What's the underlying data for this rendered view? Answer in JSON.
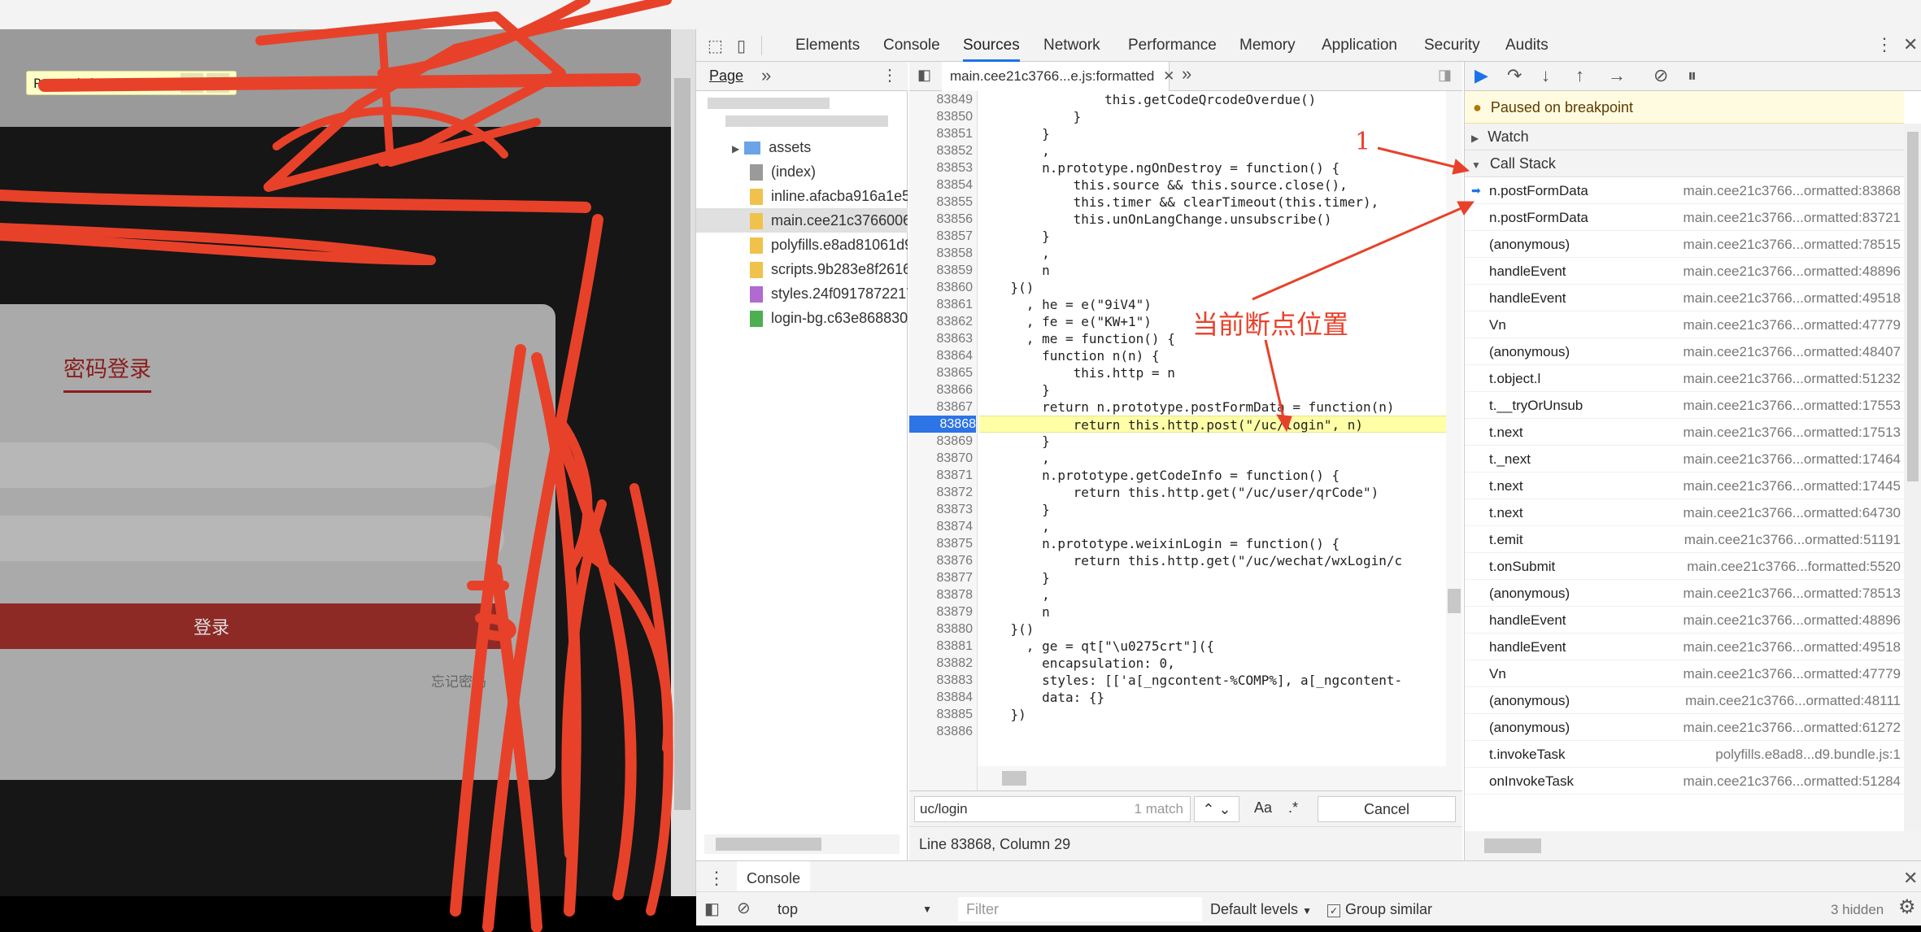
{
  "page": {
    "paused_label": "Paused in debugger",
    "login_title": "密码登录",
    "login_button": "登录",
    "forgot_link": "忘记密码"
  },
  "devtools": {
    "tabs": [
      "Elements",
      "Console",
      "Sources",
      "Network",
      "Performance",
      "Memory",
      "Application",
      "Security",
      "Audits"
    ],
    "active_tab": "Sources"
  },
  "navigator": {
    "header": "Page",
    "items": [
      {
        "label": "assets",
        "type": "folder"
      },
      {
        "label": "(index)",
        "type": "doc"
      },
      {
        "label": "inline.afacba916a1e5",
        "type": "js"
      },
      {
        "label": "main.cee21c3766006",
        "type": "js",
        "selected": true
      },
      {
        "label": "polyfills.e8ad81061d9",
        "type": "js"
      },
      {
        "label": "scripts.9b283e8f2616",
        "type": "js"
      },
      {
        "label": "styles.24f0917872217",
        "type": "js"
      },
      {
        "label": "login-bg.c63e868830",
        "type": "img"
      }
    ]
  },
  "editor": {
    "file_tab": "main.cee21c3766...e.js:formatted",
    "paused_line": "83868",
    "lines": [
      {
        "n": "83849",
        "code": "                this.getCodeQrcodeOverdue()"
      },
      {
        "n": "83850",
        "code": "            }"
      },
      {
        "n": "83851",
        "code": "        }"
      },
      {
        "n": "83852",
        "code": "        ,"
      },
      {
        "n": "83853",
        "code": "        n.prototype.ngOnDestroy = function() {"
      },
      {
        "n": "83854",
        "code": "            this.source && this.source.close(),"
      },
      {
        "n": "83855",
        "code": "            this.timer && clearTimeout(this.timer),"
      },
      {
        "n": "83856",
        "code": "            this.unOnLangChange.unsubscribe()"
      },
      {
        "n": "83857",
        "code": "        }"
      },
      {
        "n": "83858",
        "code": "        ,"
      },
      {
        "n": "83859",
        "code": "        n"
      },
      {
        "n": "83860",
        "code": "    }()"
      },
      {
        "n": "83861",
        "code": "      , he = e(\"9iV4\")"
      },
      {
        "n": "83862",
        "code": "      , fe = e(\"KW+1\")"
      },
      {
        "n": "83863",
        "code": "      , me = function() {"
      },
      {
        "n": "83864",
        "code": "        function n(n) {"
      },
      {
        "n": "83865",
        "code": "            this.http = n"
      },
      {
        "n": "83866",
        "code": "        }"
      },
      {
        "n": "83867",
        "code": "        return n.prototype.postFormData = function(n)"
      },
      {
        "n": "83868",
        "code": "            return this.http.post(\"/uc/login\", n)"
      },
      {
        "n": "83869",
        "code": "        }"
      },
      {
        "n": "83870",
        "code": "        ,"
      },
      {
        "n": "83871",
        "code": "        n.prototype.getCodeInfo = function() {"
      },
      {
        "n": "83872",
        "code": "            return this.http.get(\"/uc/user/qrCode\")"
      },
      {
        "n": "83873",
        "code": "        }"
      },
      {
        "n": "83874",
        "code": "        ,"
      },
      {
        "n": "83875",
        "code": "        n.prototype.weixinLogin = function() {"
      },
      {
        "n": "83876",
        "code": "            return this.http.get(\"/uc/wechat/wxLogin/c"
      },
      {
        "n": "83877",
        "code": "        }"
      },
      {
        "n": "83878",
        "code": "        ,"
      },
      {
        "n": "83879",
        "code": "        n"
      },
      {
        "n": "83880",
        "code": "    }()"
      },
      {
        "n": "83881",
        "code": "      , ge = qt[\"\\u0275crt\"]({"
      },
      {
        "n": "83882",
        "code": "        encapsulation: 0,"
      },
      {
        "n": "83883",
        "code": "        styles: [['a[_ngcontent-%COMP%], a[_ngcontent-"
      },
      {
        "n": "83884",
        "code": "        data: {}"
      },
      {
        "n": "83885",
        "code": "    })"
      },
      {
        "n": "83886",
        "code": ""
      }
    ],
    "search_value": "uc/login",
    "search_count": "1 match",
    "match_case": "Aa",
    "regex": ".*",
    "cancel": "Cancel",
    "status": "Line 83868, Column 29"
  },
  "debugger": {
    "paused_banner": "Paused on breakpoint",
    "watch": "Watch",
    "call_stack": "Call Stack",
    "frames": [
      {
        "name": "n.postFormData",
        "loc": "main.cee21c3766...ormatted:83868",
        "current": true
      },
      {
        "name": "n.postFormData",
        "loc": "main.cee21c3766...ormatted:83721"
      },
      {
        "name": "(anonymous)",
        "loc": "main.cee21c3766...ormatted:78515"
      },
      {
        "name": "handleEvent",
        "loc": "main.cee21c3766...ormatted:48896"
      },
      {
        "name": "handleEvent",
        "loc": "main.cee21c3766...ormatted:49518"
      },
      {
        "name": "Vn",
        "loc": "main.cee21c3766...ormatted:47779"
      },
      {
        "name": "(anonymous)",
        "loc": "main.cee21c3766...ormatted:48407"
      },
      {
        "name": "t.object.l",
        "loc": "main.cee21c3766...ormatted:51232"
      },
      {
        "name": "t.__tryOrUnsub",
        "loc": "main.cee21c3766...ormatted:17553"
      },
      {
        "name": "t.next",
        "loc": "main.cee21c3766...ormatted:17513"
      },
      {
        "name": "t._next",
        "loc": "main.cee21c3766...ormatted:17464"
      },
      {
        "name": "t.next",
        "loc": "main.cee21c3766...ormatted:17445"
      },
      {
        "name": "t.next",
        "loc": "main.cee21c3766...ormatted:64730"
      },
      {
        "name": "t.emit",
        "loc": "main.cee21c3766...ormatted:51191"
      },
      {
        "name": "t.onSubmit",
        "loc": "main.cee21c3766...formatted:5520"
      },
      {
        "name": "(anonymous)",
        "loc": "main.cee21c3766...ormatted:78513"
      },
      {
        "name": "handleEvent",
        "loc": "main.cee21c3766...ormatted:48896"
      },
      {
        "name": "handleEvent",
        "loc": "main.cee21c3766...ormatted:49518"
      },
      {
        "name": "Vn",
        "loc": "main.cee21c3766...ormatted:47779"
      },
      {
        "name": "(anonymous)",
        "loc": "main.cee21c3766...ormatted:48111"
      },
      {
        "name": "(anonymous)",
        "loc": "main.cee21c3766...ormatted:61272"
      },
      {
        "name": "t.invokeTask",
        "loc": "polyfills.e8ad8...d9.bundle.js:1"
      },
      {
        "name": "onInvokeTask",
        "loc": "main.cee21c3766...ormatted:51284"
      }
    ]
  },
  "console": {
    "drawer_tab": "Console",
    "context": "top",
    "filter_placeholder": "Filter",
    "levels": "Default levels",
    "group_similar": "Group similar",
    "hidden": "3 hidden"
  },
  "annotations": {
    "label_1": "1",
    "label_breakpoint": "当前断点位置",
    "color": "#e8412a"
  }
}
